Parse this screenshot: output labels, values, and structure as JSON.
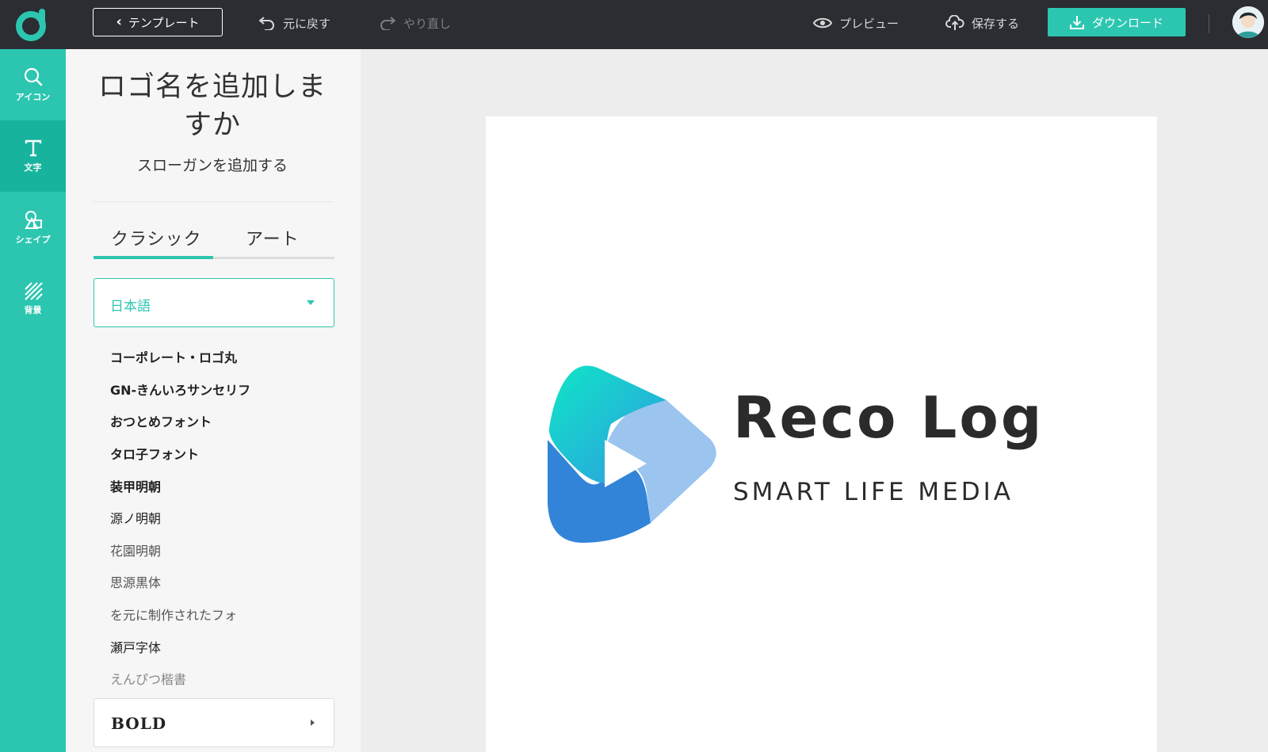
{
  "topbar": {
    "template_label": "テンプレート",
    "undo_label": "元に戻す",
    "redo_label": "やり直し",
    "preview_label": "プレビュー",
    "save_label": "保存する",
    "download_label": "ダウンロード"
  },
  "rail": {
    "items": [
      {
        "label": "アイコン",
        "icon": "search-icon"
      },
      {
        "label": "文字",
        "icon": "text-icon",
        "active": true
      },
      {
        "label": "シェイプ",
        "icon": "shape-icon"
      },
      {
        "label": "背景",
        "icon": "background-icon"
      }
    ]
  },
  "panel": {
    "logo_name_placeholder": "ロゴ名を追加しますか",
    "slogan_placeholder": "スローガンを追加する",
    "tabs": [
      {
        "label": "クラシック",
        "active": true
      },
      {
        "label": "アート"
      }
    ],
    "language_select": "日本語",
    "fonts": [
      "コーポレート・ロゴ丸",
      "GN-きんいろサンセリフ",
      "おつとめフォント",
      "タロ子フォント",
      "装甲明朝",
      "源ノ明朝",
      "花園明朝",
      "思源黒体",
      "を元に制作されたフォ",
      "瀬戸字体",
      "えんぴつ楷書"
    ],
    "bold_section_label": "BOLD"
  },
  "canvas": {
    "logo_name": "Reco Log",
    "slogan": "SMART LIFE MEDIA"
  },
  "colors": {
    "accent": "#2cc6b0",
    "topbar": "#2b2d33",
    "mark_light_blue": "#9bc4ee",
    "mark_blue": "#3284d8",
    "mark_teal": "#14e0c8"
  }
}
